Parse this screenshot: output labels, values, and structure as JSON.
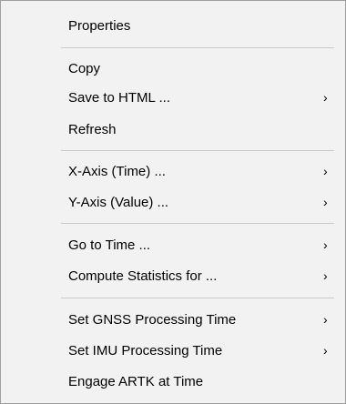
{
  "menu": {
    "submenu_glyph": "›",
    "groups": [
      [
        {
          "label": "Properties",
          "submenu": false
        }
      ],
      [
        {
          "label": "Copy",
          "submenu": false
        },
        {
          "label": "Save to HTML ...",
          "submenu": true
        },
        {
          "label": "Refresh",
          "submenu": false
        }
      ],
      [
        {
          "label": "X-Axis (Time) ...",
          "submenu": true
        },
        {
          "label": "Y-Axis (Value) ...",
          "submenu": true
        }
      ],
      [
        {
          "label": "Go to Time ...",
          "submenu": true
        },
        {
          "label": "Compute Statistics for ...",
          "submenu": true
        }
      ],
      [
        {
          "label": "Set GNSS Processing Time",
          "submenu": true
        },
        {
          "label": "Set IMU Processing Time",
          "submenu": true
        },
        {
          "label": "Engage ARTK at Time",
          "submenu": false
        }
      ]
    ]
  }
}
